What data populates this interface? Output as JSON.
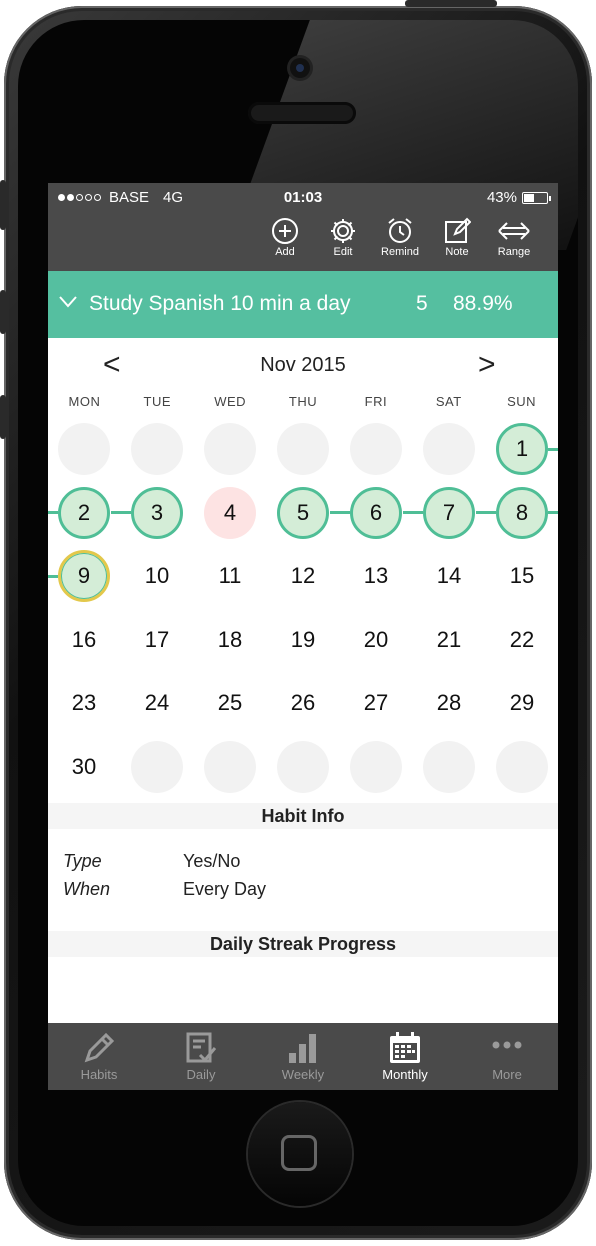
{
  "status": {
    "carrier": "BASE",
    "network": "4G",
    "time": "01:03",
    "battery": "43%",
    "battery_fraction": 0.43,
    "signal_bars_filled": 2,
    "signal_bars_total": 5
  },
  "toolbar": {
    "add": "Add",
    "edit": "Edit",
    "remind": "Remind",
    "note": "Note",
    "range": "Range"
  },
  "habit": {
    "title": "Study Spanish 10 min a day",
    "count": "5",
    "percent": "88.9%"
  },
  "month": {
    "label": "Nov 2015",
    "prev": "<",
    "next": ">"
  },
  "weekdays": [
    "MON",
    "TUE",
    "WED",
    "THU",
    "FRI",
    "SAT",
    "SUN"
  ],
  "calendar": {
    "first_weekday_index": 6,
    "days_in_month": 30,
    "completed_days": [
      1,
      2,
      3,
      5,
      6,
      7,
      8,
      9
    ],
    "missed_days": [
      4
    ],
    "today": 9
  },
  "habit_info": {
    "heading": "Habit Info",
    "type_label": "Type",
    "type_value": "Yes/No",
    "when_label": "When",
    "when_value": "Every Day"
  },
  "streak": {
    "heading": "Daily Streak Progress"
  },
  "tabs": [
    {
      "label": "Habits",
      "icon": "pencil-icon"
    },
    {
      "label": "Daily",
      "icon": "checklist-icon"
    },
    {
      "label": "Weekly",
      "icon": "bar-chart-icon"
    },
    {
      "label": "Monthly",
      "icon": "calendar-icon"
    },
    {
      "label": "More",
      "icon": "more-dots-icon"
    }
  ],
  "active_tab": 3,
  "colors": {
    "accent": "#55bfa0",
    "done_fill": "#d4edd7",
    "done_border": "#4fbe96",
    "missed_fill": "#fde3e3",
    "today_ring": "#e3c84b",
    "bar": "#4a4a4a"
  }
}
